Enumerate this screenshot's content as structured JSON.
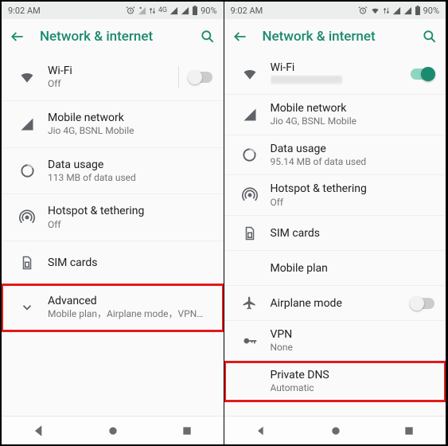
{
  "left": {
    "status": {
      "time": "9:02 AM",
      "battery": "90%",
      "net": "4G"
    },
    "title": "Network & internet",
    "rows": {
      "wifi": {
        "title": "Wi-Fi",
        "sub": "Off"
      },
      "mobile": {
        "title": "Mobile network",
        "sub": "Jio 4G, BSNL Mobile"
      },
      "data": {
        "title": "Data usage",
        "sub": "113 MB of data used"
      },
      "hotspot": {
        "title": "Hotspot & tethering",
        "sub": "Off"
      },
      "sim": {
        "title": "SIM cards"
      },
      "advanced": {
        "title": "Advanced",
        "sub": "Mobile plan，Airplane mode，VPN，Priva.."
      }
    }
  },
  "right": {
    "status": {
      "time": "9:02 AM",
      "battery": "90%"
    },
    "title": "Network & internet",
    "rows": {
      "wifi": {
        "title": "Wi-Fi"
      },
      "mobile": {
        "title": "Mobile network",
        "sub": "Jio 4G, BSNL Mobile"
      },
      "data": {
        "title": "Data usage",
        "sub": "95.14 MB of data used"
      },
      "hotspot": {
        "title": "Hotspot & tethering",
        "sub": "Off"
      },
      "sim": {
        "title": "SIM cards"
      },
      "plan": {
        "title": "Mobile plan"
      },
      "airplane": {
        "title": "Airplane mode"
      },
      "vpn": {
        "title": "VPN",
        "sub": "None"
      },
      "pdns": {
        "title": "Private DNS",
        "sub": "Automatic"
      }
    }
  }
}
